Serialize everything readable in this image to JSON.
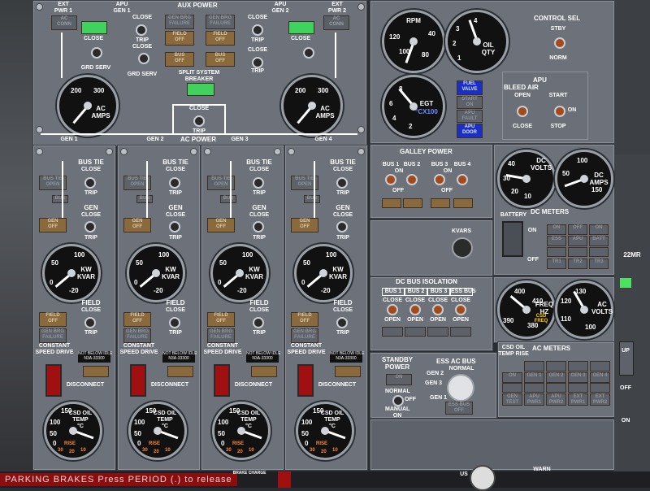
{
  "aux_power": {
    "title": "AUX POWER",
    "ext_pwr1": "EXT\nPWR 1",
    "ext_pwr2": "EXT\nPWR 2",
    "apu_gen1": "APU\nGEN 1",
    "apu_gen2": "APU\nGEN 2",
    "ac_conn": "AC\nCONN",
    "close": "CLOSE",
    "trip": "TRIP",
    "on": "ON",
    "off": "OFF",
    "grd_serv": "GRD SERV",
    "gen_brg_failure": "GEN BRG\nFAILURE",
    "field_off": "FIELD\nOFF",
    "bus_off": "BUS\nOFF",
    "split_system_breaker": "SPLIT SYSTEM\nBREAKER",
    "ac_amps": "AC\nAMPS",
    "amp_ticks": [
      "200",
      "300"
    ]
  },
  "ac_power": {
    "title": "AC POWER",
    "gen_labels": [
      "GEN 1",
      "GEN 2",
      "GEN 3",
      "GEN 4"
    ],
    "close": "CLOSE",
    "trip": "TRIP"
  },
  "gen_panels": {
    "bus_tie": "BUS TIE",
    "close": "CLOSE",
    "trip": "TRIP",
    "bus_tie_open": "BUS TIE\nOPEN",
    "bus": "BUS",
    "gen": "GEN",
    "gen_off": "GEN\nOFF",
    "kw_kvar": "KW\nKVAR",
    "kw_ticks": [
      "50",
      "100",
      "0",
      "-20"
    ],
    "field": "FIELD",
    "field_off": "FIELD\nOFF",
    "gen_brg_failure": "GEN BRG\nFAILURE",
    "constant_speed_drive": "CONSTANT\nSPEED DRIVE",
    "not_below_idle": "NOT BELOW IDLE\nN3A-33300",
    "disconnect": "DISCONNECT",
    "csd_oil_temp": "CSD OIL\nTEMP\n°C",
    "csd_ticks": [
      "150",
      "100",
      "50",
      "0"
    ],
    "rise": "RISE",
    "rise_ticks": [
      "30",
      "20",
      "10"
    ]
  },
  "apu": {
    "rpm_label": "RPM",
    "rpm_ticks": [
      "120",
      "100",
      "40",
      "80",
      "60"
    ],
    "oil_qty": "OIL\nQTY",
    "oil_ticks": [
      "4",
      "3",
      "2",
      "1",
      "0"
    ],
    "egt_label": "EGT",
    "egt_scale": "°CX100",
    "egt_ticks": [
      "8",
      "6",
      "4",
      "2",
      "0"
    ],
    "fuel_valve": "FUEL\nVALVE",
    "start_on": "START\nON",
    "apu_fault": "APU\nFAULT",
    "apu_door": "APU\nDOOR",
    "control_sel": "CONTROL SEL",
    "stby": "STBY",
    "norm": "NORM",
    "apu_title": "APU",
    "bleed_air": "BLEED AIR",
    "open": "OPEN",
    "close": "CLOSE",
    "start": "START",
    "on": "ON",
    "stop": "STOP"
  },
  "galley_power": {
    "title": "GALLEY POWER",
    "buses": [
      "BUS 1",
      "BUS 2",
      "BUS 3",
      "BUS 4"
    ],
    "on": "ON",
    "off": "OFF",
    "kvars": "KVARS"
  },
  "dc_meters": {
    "dc_volts": "DC\nVOLTS",
    "dc_amps": "DC\nAMPS",
    "volts_ticks": [
      "40",
      "30",
      "20",
      "10",
      "0"
    ],
    "amps_ticks": [
      "100",
      "50",
      "150",
      "0"
    ],
    "title": "DC METERS",
    "battery": "BATTERY",
    "on": "ON",
    "off": "OFF",
    "buttons": [
      "ESS",
      "APU",
      "BATT",
      "TR1",
      "TR2",
      "TR3"
    ],
    "row1": [
      "ON",
      "OFF",
      "ON"
    ]
  },
  "dc_bus_isolation": {
    "title": "DC BUS ISOLATION",
    "buses": [
      "BUS 1",
      "BUS 2",
      "BUS 3",
      "ESS BUS"
    ],
    "close": "CLOSE",
    "open": "OPEN"
  },
  "freq_volts": {
    "freq": "FREQ\nHZ",
    "freq_ticks": [
      "400",
      "410",
      "390",
      "380"
    ],
    "ac_volts": "AC\nVOLTS",
    "volts_ticks": [
      "130",
      "120",
      "110",
      "100"
    ],
    "csd_freq": "CSD\nFREQ",
    "csd_oil_temp": "CSD OIL\nTEMP RISE"
  },
  "standby_power": {
    "title": "STANDBY\nPOWER",
    "on": "ON",
    "normal": "NORMAL",
    "off": "OFF",
    "manual_on": "MANUAL\nON",
    "ess_ac_bus": "ESS AC BUS",
    "ess_normal": "NORMAL",
    "gen_labels": [
      "GEN 2",
      "GEN 3",
      "GEN 1"
    ],
    "ess_bus_off": "ESS BUS\nOFF"
  },
  "ac_meters": {
    "title": "AC METERS",
    "row1": [
      "ON",
      "GEN 1",
      "GEN 2",
      "GEN 3",
      "GEN 4"
    ],
    "row2": [
      "GEN TEST",
      "APU PWR1",
      "APU PWR2",
      "EXT PWR1",
      "EXT PWR2"
    ]
  },
  "right_strip": {
    "up": "UP",
    "off": "OFF",
    "on": "ON",
    "mr": "22MR"
  },
  "bottom_bar": {
    "parking_msg": "PARKING BRAKES   Press PERIOD (.) to release",
    "brake_charge": "BRAKE CHARGE",
    "warn": "WARN",
    "us": "US"
  }
}
